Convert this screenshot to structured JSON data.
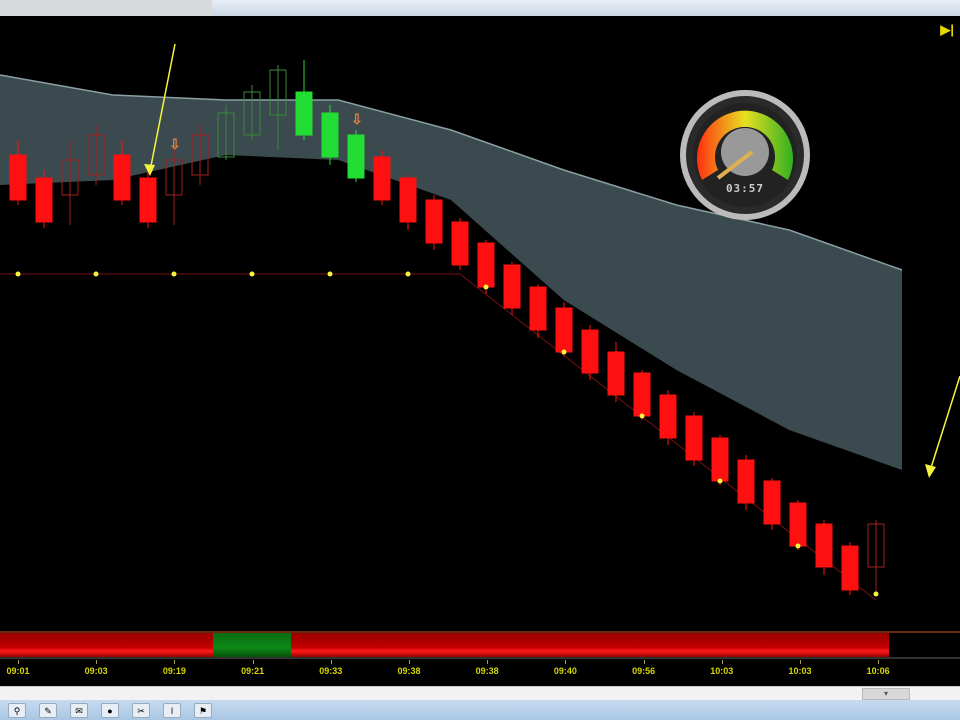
{
  "window": {
    "gauge_time": "03:57",
    "play_icon": "skip-end-icon"
  },
  "colors": {
    "bear": "#ff1010",
    "bull": "#22dd33",
    "band": "#3a4a4e",
    "band_edge": "#8aa0a4",
    "dot": "#f5f540",
    "axis_text": "#d6d600"
  },
  "chart_data": {
    "type": "candlestick",
    "price_note": "arbitrary price units",
    "candles": [
      {
        "o": 445,
        "c": 400,
        "h": 460,
        "l": 395,
        "style": "bear"
      },
      {
        "o": 422,
        "c": 378,
        "h": 430,
        "l": 372,
        "style": "bear"
      },
      {
        "o": 440,
        "c": 405,
        "h": 460,
        "l": 375,
        "style": "bear-hollow"
      },
      {
        "o": 465,
        "c": 425,
        "h": 475,
        "l": 415,
        "style": "bear-hollow"
      },
      {
        "o": 445,
        "c": 400,
        "h": 460,
        "l": 395,
        "style": "bear"
      },
      {
        "o": 422,
        "c": 378,
        "h": 430,
        "l": 372,
        "style": "bear"
      },
      {
        "o": 440,
        "c": 405,
        "h": 455,
        "l": 375,
        "style": "bear-hollow"
      },
      {
        "o": 465,
        "c": 425,
        "h": 475,
        "l": 415,
        "style": "bear-hollow"
      },
      {
        "o": 443,
        "c": 487,
        "h": 495,
        "l": 440,
        "style": "bull-hollow"
      },
      {
        "o": 465,
        "c": 508,
        "h": 515,
        "l": 460,
        "style": "bull-hollow"
      },
      {
        "o": 485,
        "c": 530,
        "h": 535,
        "l": 450,
        "style": "bull-hollow"
      },
      {
        "o": 465,
        "c": 508,
        "h": 540,
        "l": 460,
        "style": "bull"
      },
      {
        "o": 443,
        "c": 487,
        "h": 495,
        "l": 435,
        "style": "bull"
      },
      {
        "o": 422,
        "c": 465,
        "h": 470,
        "l": 418,
        "style": "bull"
      },
      {
        "o": 443,
        "c": 400,
        "h": 450,
        "l": 395,
        "style": "bear"
      },
      {
        "o": 422,
        "c": 378,
        "h": 425,
        "l": 370,
        "style": "bear"
      },
      {
        "o": 400,
        "c": 357,
        "h": 405,
        "l": 350,
        "style": "bear"
      },
      {
        "o": 378,
        "c": 335,
        "h": 382,
        "l": 330,
        "style": "bear"
      },
      {
        "o": 357,
        "c": 313,
        "h": 360,
        "l": 306,
        "style": "bear"
      },
      {
        "o": 335,
        "c": 292,
        "h": 338,
        "l": 285,
        "style": "bear"
      },
      {
        "o": 313,
        "c": 270,
        "h": 316,
        "l": 262,
        "style": "bear"
      },
      {
        "o": 292,
        "c": 248,
        "h": 298,
        "l": 244,
        "style": "bear"
      },
      {
        "o": 270,
        "c": 227,
        "h": 275,
        "l": 220,
        "style": "bear"
      },
      {
        "o": 248,
        "c": 205,
        "h": 258,
        "l": 198,
        "style": "bear"
      },
      {
        "o": 227,
        "c": 184,
        "h": 230,
        "l": 180,
        "style": "bear"
      },
      {
        "o": 205,
        "c": 162,
        "h": 210,
        "l": 155,
        "style": "bear"
      },
      {
        "o": 184,
        "c": 140,
        "h": 188,
        "l": 134,
        "style": "bear"
      },
      {
        "o": 162,
        "c": 119,
        "h": 165,
        "l": 115,
        "style": "bear"
      },
      {
        "o": 140,
        "c": 97,
        "h": 145,
        "l": 90,
        "style": "bear"
      },
      {
        "o": 119,
        "c": 76,
        "h": 122,
        "l": 70,
        "style": "bear"
      },
      {
        "o": 97,
        "c": 54,
        "h": 100,
        "l": 50,
        "style": "bear"
      },
      {
        "o": 76,
        "c": 33,
        "h": 80,
        "l": 25,
        "style": "bear"
      },
      {
        "o": 54,
        "c": 10,
        "h": 58,
        "l": 5,
        "style": "bear"
      },
      {
        "o": 76,
        "c": 33,
        "h": 80,
        "l": 6,
        "style": "bear-hollow"
      }
    ],
    "band_upper": [
      525,
      505,
      500,
      500,
      470,
      430,
      395,
      370,
      330
    ],
    "band_lower": [
      415,
      420,
      445,
      440,
      400,
      300,
      230,
      170,
      130
    ],
    "dots": [
      {
        "i": 0,
        "p": 326
      },
      {
        "i": 3,
        "p": 326
      },
      {
        "i": 6,
        "p": 326
      },
      {
        "i": 9,
        "p": 326
      },
      {
        "i": 12,
        "p": 326
      },
      {
        "i": 15,
        "p": 326
      },
      {
        "i": 18,
        "p": 313
      },
      {
        "i": 21,
        "p": 248
      },
      {
        "i": 24,
        "p": 184
      },
      {
        "i": 27,
        "p": 119
      },
      {
        "i": 30,
        "p": 54
      },
      {
        "i": 33,
        "p": 6
      }
    ],
    "signal_bar": [
      {
        "state": "bear",
        "from": 0,
        "to": 8
      },
      {
        "state": "bull",
        "from": 8,
        "to": 11
      },
      {
        "state": "bear",
        "from": 11,
        "to": 34
      }
    ],
    "x_ticks": [
      "09:01",
      "09:03",
      "09:19",
      "09:21",
      "09:33",
      "09:38",
      "09:38",
      "09:40",
      "09:56",
      "10:03",
      "10:03",
      "10:06"
    ]
  },
  "taskbar": {
    "icons": [
      "app-icon-1",
      "app-icon-2",
      "app-icon-3",
      "app-icon-4",
      "app-icon-5",
      "app-icon-6",
      "app-icon-7"
    ]
  }
}
